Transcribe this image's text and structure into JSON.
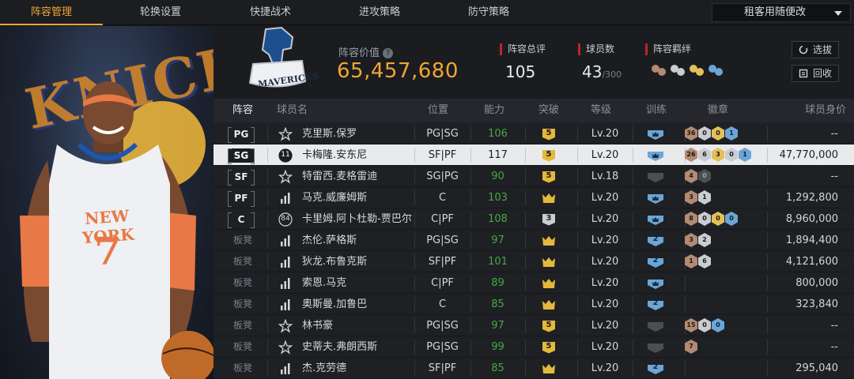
{
  "nav": {
    "tabs": [
      "阵容管理",
      "轮换设置",
      "快捷战术",
      "进攻策略",
      "防守策略"
    ],
    "active": 0,
    "dropdown_value": "租客用随便改"
  },
  "player_art": {
    "jersey_team": "NEW YORK",
    "jersey_number": "7",
    "backdrop_text": "KNICKS"
  },
  "header": {
    "team_logo_text": "MAVERICKS",
    "value_label": "阵容价值",
    "value": "65,457,680",
    "total_rating_label": "阵容总评",
    "total_rating": "105",
    "player_count_label": "球员数",
    "player_count": "43",
    "player_count_max": "/300",
    "bond_label": "阵容羁绊",
    "btn_select": "选拔",
    "btn_recycle": "回收"
  },
  "table": {
    "headers": [
      "阵容",
      "球员名",
      "位置",
      "能力",
      "突破",
      "等级",
      "训练",
      "徽章",
      "球员身价"
    ],
    "rows": [
      {
        "slot": "PG",
        "bench": false,
        "icon": "star",
        "name": "克里斯.保罗",
        "pos": "PG|SG",
        "ability": "106",
        "green": true,
        "breakthrough": "5",
        "bt_kind": "gold",
        "level": "Lv.20",
        "train": "crown",
        "train_kind": "blue",
        "badges": [
          [
            "36",
            "bronze"
          ],
          [
            "0",
            "silver"
          ],
          [
            "0",
            "gold"
          ],
          [
            "1",
            "blue"
          ]
        ],
        "price": "--",
        "selected": false
      },
      {
        "slot": "SG",
        "bench": false,
        "icon": "jersey",
        "icon_text": "11",
        "name": "卡梅隆.安东尼",
        "pos": "SF|PF",
        "ability": "117",
        "green": false,
        "breakthrough": "5",
        "bt_kind": "gold",
        "level": "Lv.20",
        "train": "crown",
        "train_kind": "blue",
        "badges": [
          [
            "26",
            "bronze"
          ],
          [
            "6",
            "silver"
          ],
          [
            "3",
            "gold"
          ],
          [
            "0",
            "silver"
          ],
          [
            "1",
            "blue"
          ]
        ],
        "price": "47,770,000",
        "selected": true
      },
      {
        "slot": "SF",
        "bench": false,
        "icon": "star",
        "name": "特雷西.麦格雷迪",
        "pos": "SG|PG",
        "ability": "90",
        "green": true,
        "breakthrough": "5",
        "bt_kind": "gold",
        "level": "Lv.18",
        "train": "none",
        "train_kind": "dark",
        "badges": [
          [
            "4",
            "bronze"
          ],
          [
            "0",
            "dark"
          ]
        ],
        "price": "--",
        "selected": false
      },
      {
        "slot": "PF",
        "bench": false,
        "icon": "bars",
        "name": "马克.威廉姆斯",
        "pos": "C",
        "ability": "103",
        "green": true,
        "breakthrough": "",
        "bt_kind": "crown",
        "level": "Lv.20",
        "train": "crown",
        "train_kind": "blue",
        "badges": [
          [
            "3",
            "bronze"
          ],
          [
            "1",
            "silver"
          ]
        ],
        "price": "1,292,800",
        "selected": false
      },
      {
        "slot": "C",
        "bench": false,
        "icon": "jersey",
        "icon_text": "84",
        "name": "卡里姆.阿卜杜勒-贾巴尔",
        "pos": "C|PF",
        "ability": "108",
        "green": true,
        "breakthrough": "3",
        "bt_kind": "silver",
        "level": "Lv.20",
        "train": "crown",
        "train_kind": "blue",
        "badges": [
          [
            "8",
            "bronze"
          ],
          [
            "0",
            "silver"
          ],
          [
            "0",
            "gold"
          ],
          [
            "0",
            "blue"
          ]
        ],
        "price": "8,960,000",
        "selected": false
      },
      {
        "slot": "板凳",
        "bench": true,
        "icon": "bars",
        "name": "杰伦.萨格斯",
        "pos": "PG|SG",
        "ability": "97",
        "green": true,
        "breakthrough": "",
        "bt_kind": "crown",
        "level": "Lv.20",
        "train": "2",
        "train_kind": "blue",
        "badges": [
          [
            "3",
            "bronze"
          ],
          [
            "2",
            "silver"
          ]
        ],
        "price": "1,894,400",
        "selected": false
      },
      {
        "slot": "板凳",
        "bench": true,
        "icon": "bars",
        "name": "狄龙.布鲁克斯",
        "pos": "SF|PF",
        "ability": "101",
        "green": true,
        "breakthrough": "",
        "bt_kind": "crown",
        "level": "Lv.20",
        "train": "2",
        "train_kind": "blue",
        "badges": [
          [
            "1",
            "bronze"
          ],
          [
            "6",
            "silver"
          ]
        ],
        "price": "4,121,600",
        "selected": false
      },
      {
        "slot": "板凳",
        "bench": true,
        "icon": "bars",
        "name": "索恩.马克",
        "pos": "C|PF",
        "ability": "89",
        "green": true,
        "breakthrough": "",
        "bt_kind": "crown",
        "level": "Lv.20",
        "train": "crown",
        "train_kind": "blue",
        "badges": [],
        "price": "800,000",
        "selected": false
      },
      {
        "slot": "板凳",
        "bench": true,
        "icon": "bars",
        "name": "奥斯曼.加鲁巴",
        "pos": "C",
        "ability": "85",
        "green": true,
        "breakthrough": "",
        "bt_kind": "crown",
        "level": "Lv.20",
        "train": "2",
        "train_kind": "blue",
        "badges": [],
        "price": "323,840",
        "selected": false
      },
      {
        "slot": "板凳",
        "bench": true,
        "icon": "star",
        "name": "林书豪",
        "pos": "PG|SG",
        "ability": "97",
        "green": true,
        "breakthrough": "5",
        "bt_kind": "gold",
        "level": "Lv.20",
        "train": "none",
        "train_kind": "dark",
        "badges": [
          [
            "15",
            "bronze"
          ],
          [
            "0",
            "silver"
          ],
          [
            "0",
            "blue"
          ]
        ],
        "price": "--",
        "selected": false
      },
      {
        "slot": "板凳",
        "bench": true,
        "icon": "star",
        "name": "史蒂夫.弗朗西斯",
        "pos": "PG|SG",
        "ability": "99",
        "green": true,
        "breakthrough": "5",
        "bt_kind": "gold",
        "level": "Lv.20",
        "train": "none",
        "train_kind": "dark",
        "badges": [
          [
            "7",
            "bronze"
          ]
        ],
        "price": "--",
        "selected": false
      },
      {
        "slot": "板凳",
        "bench": true,
        "icon": "bars",
        "name": "杰.克劳德",
        "pos": "SF|PF",
        "ability": "85",
        "green": true,
        "breakthrough": "",
        "bt_kind": "crown",
        "level": "Lv.20",
        "train": "2",
        "train_kind": "blue",
        "badges": [],
        "price": "295,040",
        "selected": false
      }
    ]
  },
  "colors": {
    "accent": "#f2a533",
    "green": "#47a842",
    "selected_row": "#e9eaec",
    "stat_marker": "#c0232b"
  }
}
